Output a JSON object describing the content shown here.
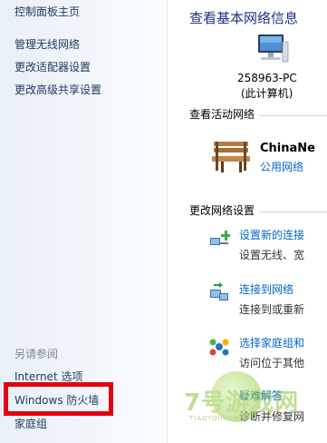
{
  "sidebar": {
    "home": "控制面板主页",
    "links": [
      "管理无线网络",
      "更改适配器设置",
      "更改高级共享设置"
    ],
    "see_also_label": "另请参阅",
    "see_also": [
      "Internet 选项",
      "Windows 防火墙",
      "家庭组"
    ],
    "highlight_color": "#e3000f"
  },
  "main": {
    "title": "查看基本网络信息",
    "computer": {
      "icon": "computer-icon",
      "name": "258963-PC",
      "sub": "(此计算机)"
    },
    "active_networks": {
      "heading": "查看活动网络",
      "network": {
        "icon": "bench-icon",
        "name": "ChinaNe",
        "type": "公用网络"
      }
    },
    "change_settings": {
      "heading": "更改网络设置",
      "tasks": [
        {
          "icon": "new-connection-icon",
          "link": "设置新的连接",
          "desc": "设置无线、宽"
        },
        {
          "icon": "connect-network-icon",
          "link": "连接到网络",
          "desc": "连接到或重新"
        },
        {
          "icon": "homegroup-icon",
          "link": "选择家庭组和",
          "desc": "访问位于其他"
        },
        {
          "icon": "troubleshoot-icon",
          "link": "疑难解答",
          "desc": "诊断并修复网"
        }
      ]
    }
  },
  "watermark": {
    "text": "7号游戏网",
    "sub": "TIAOYOUXI.NET"
  },
  "colors": {
    "title": "#1e3287",
    "link": "#0066cc",
    "sidebar_link": "#1e395b"
  }
}
